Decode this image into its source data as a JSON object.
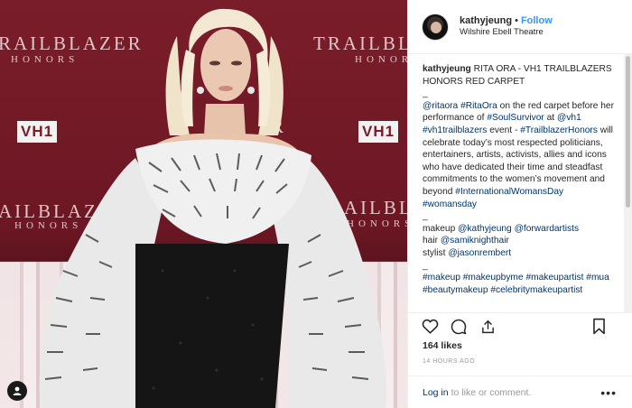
{
  "photo": {
    "backdrop": {
      "trailblazer_left": "RAILBLAZER",
      "honors_left": "HONORS",
      "trailblazer_right": "TRAILBLA",
      "honors_right": "HONOR",
      "trailblazer_mid_left": "AILBLAZ",
      "honors_mid_left": "HONORS",
      "trailblazer_mid_right": "TRAILBLAZ",
      "honors_mid_right": "HONORS",
      "vh1_left": "VH1",
      "vh1_right": "VH1",
      "fragment_r": "R"
    }
  },
  "post": {
    "username": "kathyjeung",
    "follow_label": "Follow",
    "location": "Wilshire Ebell Theatre",
    "caption": {
      "username": "kathyjeung",
      "title": "RITA ORA - VH1 TRAILBLAZERS HONORS RED CARPET",
      "separator": "_",
      "tag_ritaora": "@ritaora",
      "tag_ritaora2": "#RitaOra",
      "text_1": "on the red carpet before her performance of",
      "tag_soulsurvivor": "#SoulSurvivor",
      "text_at": "at",
      "tag_vh1": "@vh1",
      "tag_vh1trail": "#vh1trailblazers",
      "text_event": "event -",
      "tag_trailhonors": "#TrailblazerHonors",
      "text_2": "will celebrate today’s most respected politicians, entertainers, artists, activists, allies and icons who have dedicated their time and steadfast commitments to the women’s movement and beyond",
      "tag_iwd": "#InternationalWomansDay",
      "tag_womansday": "#womansday",
      "separator_2": "_",
      "makeup_label": "makeup",
      "makeup_tag1": "@kathyjeung",
      "makeup_tag2": "@forwardartists",
      "hair_label": "hair",
      "hair_tag": "@samiknighthair",
      "stylist_label": "stylist",
      "stylist_tag": "@jasonrembert",
      "separator_3": "_",
      "tag_makeup": "#makeup",
      "tag_makeupbyme": "#makeupbyme",
      "tag_makeupartist": "#makeupartist",
      "tag_mua": "#mua",
      "tag_beautymakeup": "#beautymakeup",
      "tag_celeb": "#celebritymakeupartist"
    },
    "likes": "164 likes",
    "time": "14 HOURS AGO",
    "login_link": "Log in",
    "login_text": "to like or comment.",
    "more": "•••"
  },
  "icons": {
    "heart": "heart-icon",
    "comment": "comment-icon",
    "share": "share-icon",
    "bookmark": "bookmark-icon",
    "camera": "tagged-people-icon"
  },
  "colors": {
    "link_blue": "#003569",
    "follow_blue": "#3897f0",
    "backdrop_red": "#7a1d2a"
  }
}
